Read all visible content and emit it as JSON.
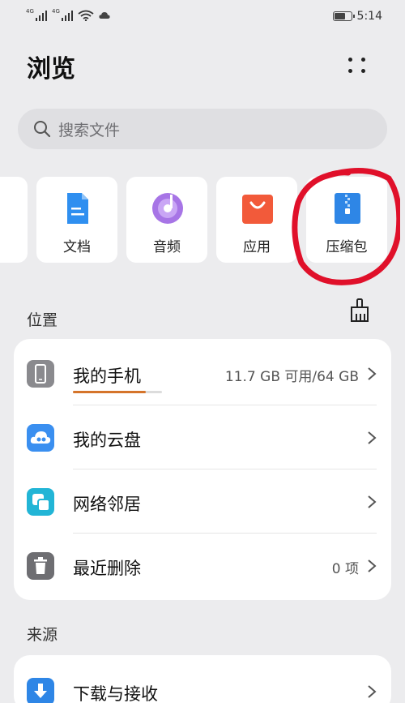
{
  "status_bar": {
    "signal_1": "4G",
    "signal_2": "4G",
    "time": "5:14"
  },
  "header": {
    "title": "浏览",
    "more_icon": "more-dots-icon"
  },
  "search": {
    "placeholder": "搜索文件",
    "icon": "search-icon"
  },
  "categories": [
    {
      "label": "文档",
      "icon": "document-icon",
      "color": "#2f8ff0"
    },
    {
      "label": "音频",
      "icon": "audio-icon",
      "color": "#a775e6"
    },
    {
      "label": "应用",
      "icon": "app-bag-icon",
      "color": "#f25a3a"
    },
    {
      "label": "压缩包",
      "icon": "zip-icon",
      "color": "#2e86e6"
    }
  ],
  "location": {
    "section_label": "位置",
    "clean_icon": "broom-icon",
    "items": [
      {
        "label": "我的手机",
        "value": "11.7 GB 可用/64 GB",
        "icon": "phone-icon",
        "color": "#8a8a8e",
        "usage_used_fraction": 0.82
      },
      {
        "label": "我的云盘",
        "value": "",
        "icon": "cloud-icon",
        "color": "#3a8ff0"
      },
      {
        "label": "网络邻居",
        "value": "",
        "icon": "network-icon",
        "color": "#22b5d6"
      },
      {
        "label": "最近删除",
        "value": "0 项",
        "icon": "trash-icon",
        "color": "#6e6e72"
      }
    ]
  },
  "source": {
    "section_label": "来源",
    "items": [
      {
        "label": "下载与接收",
        "icon": "download-icon",
        "color": "#2e86e6"
      }
    ]
  },
  "colors": {
    "background": "#ececee",
    "annotation_circle": "#e0102a",
    "usage_bar": "#d5742a"
  }
}
